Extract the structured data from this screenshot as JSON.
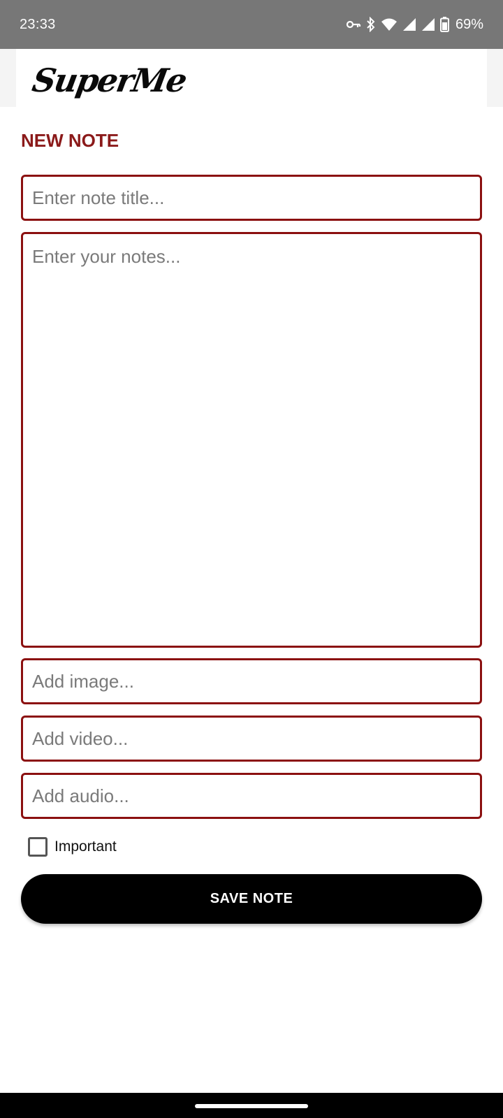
{
  "status_bar": {
    "time": "23:33",
    "battery_percent": "69%",
    "icons": [
      "vpn-key-icon",
      "bluetooth-icon",
      "wifi-icon",
      "signal-icon",
      "signal-icon",
      "battery-icon"
    ]
  },
  "header": {
    "logo_text": "SuperMe"
  },
  "page": {
    "title": "NEW NOTE"
  },
  "form": {
    "title_placeholder": "Enter note title...",
    "notes_placeholder": "Enter your notes...",
    "image_placeholder": "Add image...",
    "video_placeholder": "Add video...",
    "audio_placeholder": "Add audio...",
    "important_label": "Important",
    "important_checked": false,
    "save_label": "SAVE NOTE"
  },
  "colors": {
    "accent": "#8b1010",
    "status_bar": "#777777",
    "button": "#000000"
  }
}
